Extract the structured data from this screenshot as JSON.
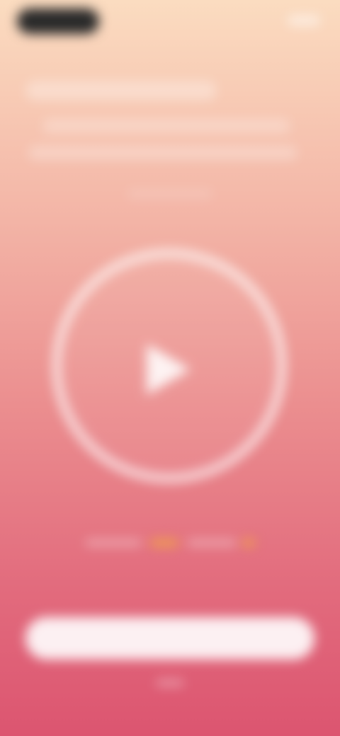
{
  "status_bar": {
    "time": "",
    "indicators": ""
  },
  "header": {
    "title": "",
    "subtitle_line1": "",
    "subtitle_line2": "",
    "hint": ""
  },
  "player": {
    "play_icon": "play-icon"
  },
  "pager": {
    "active_index": 1,
    "dot_count": 4,
    "accent": "#f0a04b"
  },
  "cta": {
    "label": ""
  },
  "footer": {
    "text": ""
  },
  "colors": {
    "bg_top": "#fbdcc0",
    "bg_mid": "#eb8e8f",
    "bg_bottom": "#dc5570"
  }
}
